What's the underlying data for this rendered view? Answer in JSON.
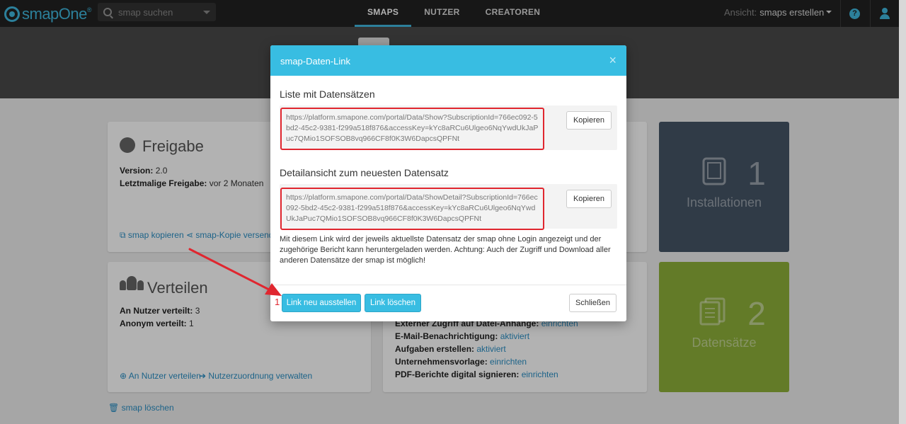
{
  "app": {
    "logo": "smapOne"
  },
  "search": {
    "placeholder": "smap suchen"
  },
  "nav": {
    "tabs": [
      "SMAPS",
      "NUTZER",
      "CREATOREN"
    ]
  },
  "view": {
    "label": "Ansicht:",
    "value": "smaps erstellen"
  },
  "help": {
    "glyph": "?"
  },
  "freigabe": {
    "title": "Freigabe",
    "version_label": "Version:",
    "version_value": "2.0",
    "last_label": "Letztmalige Freigabe:",
    "last_value": "vor 2 Monaten",
    "copy_link": "smap kopieren",
    "send_link": "smap-Kopie versenden"
  },
  "verteilen": {
    "title": "Verteilen",
    "users_label": "An Nutzer verteilt:",
    "users_value": "3",
    "anon_label": "Anonym verteilt:",
    "anon_value": "1",
    "distribute_link": "An Nutzer verteilen",
    "manage_link": "Nutzerzuordnung verwalten"
  },
  "settings": {
    "rows": [
      {
        "label": "Externer Zugriff auf Datei-Anhänge:",
        "value": "einrichten"
      },
      {
        "label": "E-Mail-Benachrichtigung:",
        "value": "aktiviert"
      },
      {
        "label": "Aufgaben erstellen:",
        "value": "aktiviert"
      },
      {
        "label": "Unternehmensvorlage:",
        "value": "einrichten"
      },
      {
        "label": "PDF-Berichte digital signieren:",
        "value": "einrichten"
      }
    ]
  },
  "stats": {
    "installations": {
      "count": "1",
      "label": "Installationen",
      "color": "#455566"
    },
    "records": {
      "count": "2",
      "label": "Datensätze",
      "color": "#8fb03a"
    }
  },
  "delete_smap": "smap löschen",
  "modal": {
    "title": "smap-Daten-Link",
    "close": "×",
    "list_title": "Liste mit Datensätzen",
    "list_url": "https://platform.smapone.com/portal/Data/Show?SubscriptionId=766ec092-5bd2-45c2-9381-f299a518f876&accessKey=kYc8aRCu6Ulgeo6NqYwdUkJaPuc7QMio1SOFSOB8vq966CF8f0K3W6DapcsQPFNt",
    "copy_label": "Kopieren",
    "detail_title": "Detailansicht zum neuesten Datensatz",
    "detail_url": "https://platform.smapone.com/portal/Data/ShowDetail?SubscriptionId=766ec092-5bd2-45c2-9381-f299a518f876&accessKey=kYc8aRCu6Ulgeo6NqYwdUkJaPuc7QMio1SOFSOB8vq966CF8f0K3W6DapcsQPFNt",
    "hint": "Mit diesem Link wird der jeweils aktuellste Datensatz der smap ohne Login angezeigt und der zugehörige Bericht kann heruntergeladen werden. Achtung: Auch der Zugriff und Download aller anderen Datensätze der smap ist möglich!",
    "reissue_label": "Link neu ausstellen",
    "delete_label": "Link löschen",
    "close_label": "Schließen",
    "step_marker": "1"
  },
  "colors": {
    "accent": "#38bde2",
    "highlight": "#e0262f"
  }
}
